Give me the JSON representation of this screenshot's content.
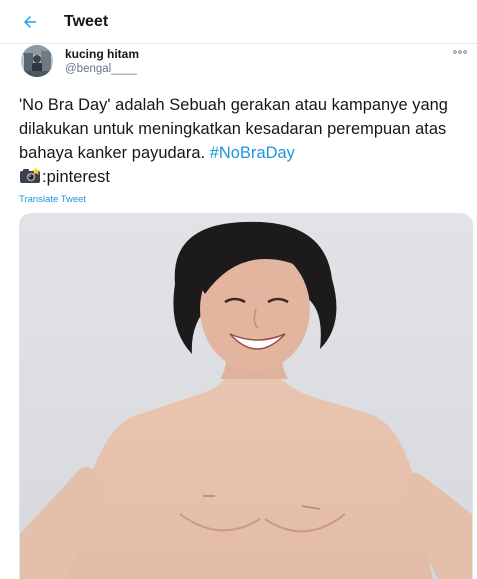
{
  "header": {
    "title": "Tweet",
    "back_icon": "arrow-left-icon"
  },
  "author": {
    "name": "kucing hitam",
    "handle": "@bengal____",
    "avatar_icon": "avatar-photo"
  },
  "tweet": {
    "text_part1": "'No Bra Day' adalah Sebuah gerakan atau kampanye yang dilakukan untuk meningkatkan kesadaran perempuan atas bahaya kanker payudara. ",
    "hashtag": "#NoBraDay",
    "text_part2": ":pinterest",
    "camera_icon": "camera-flash-emoji"
  },
  "translate_label": "Translate Tweet",
  "more_icon": "more-dots-icon",
  "colors": {
    "accent": "#1b95e0",
    "text": "#14171a",
    "muted": "#657786",
    "border": "#e6ecf0"
  }
}
